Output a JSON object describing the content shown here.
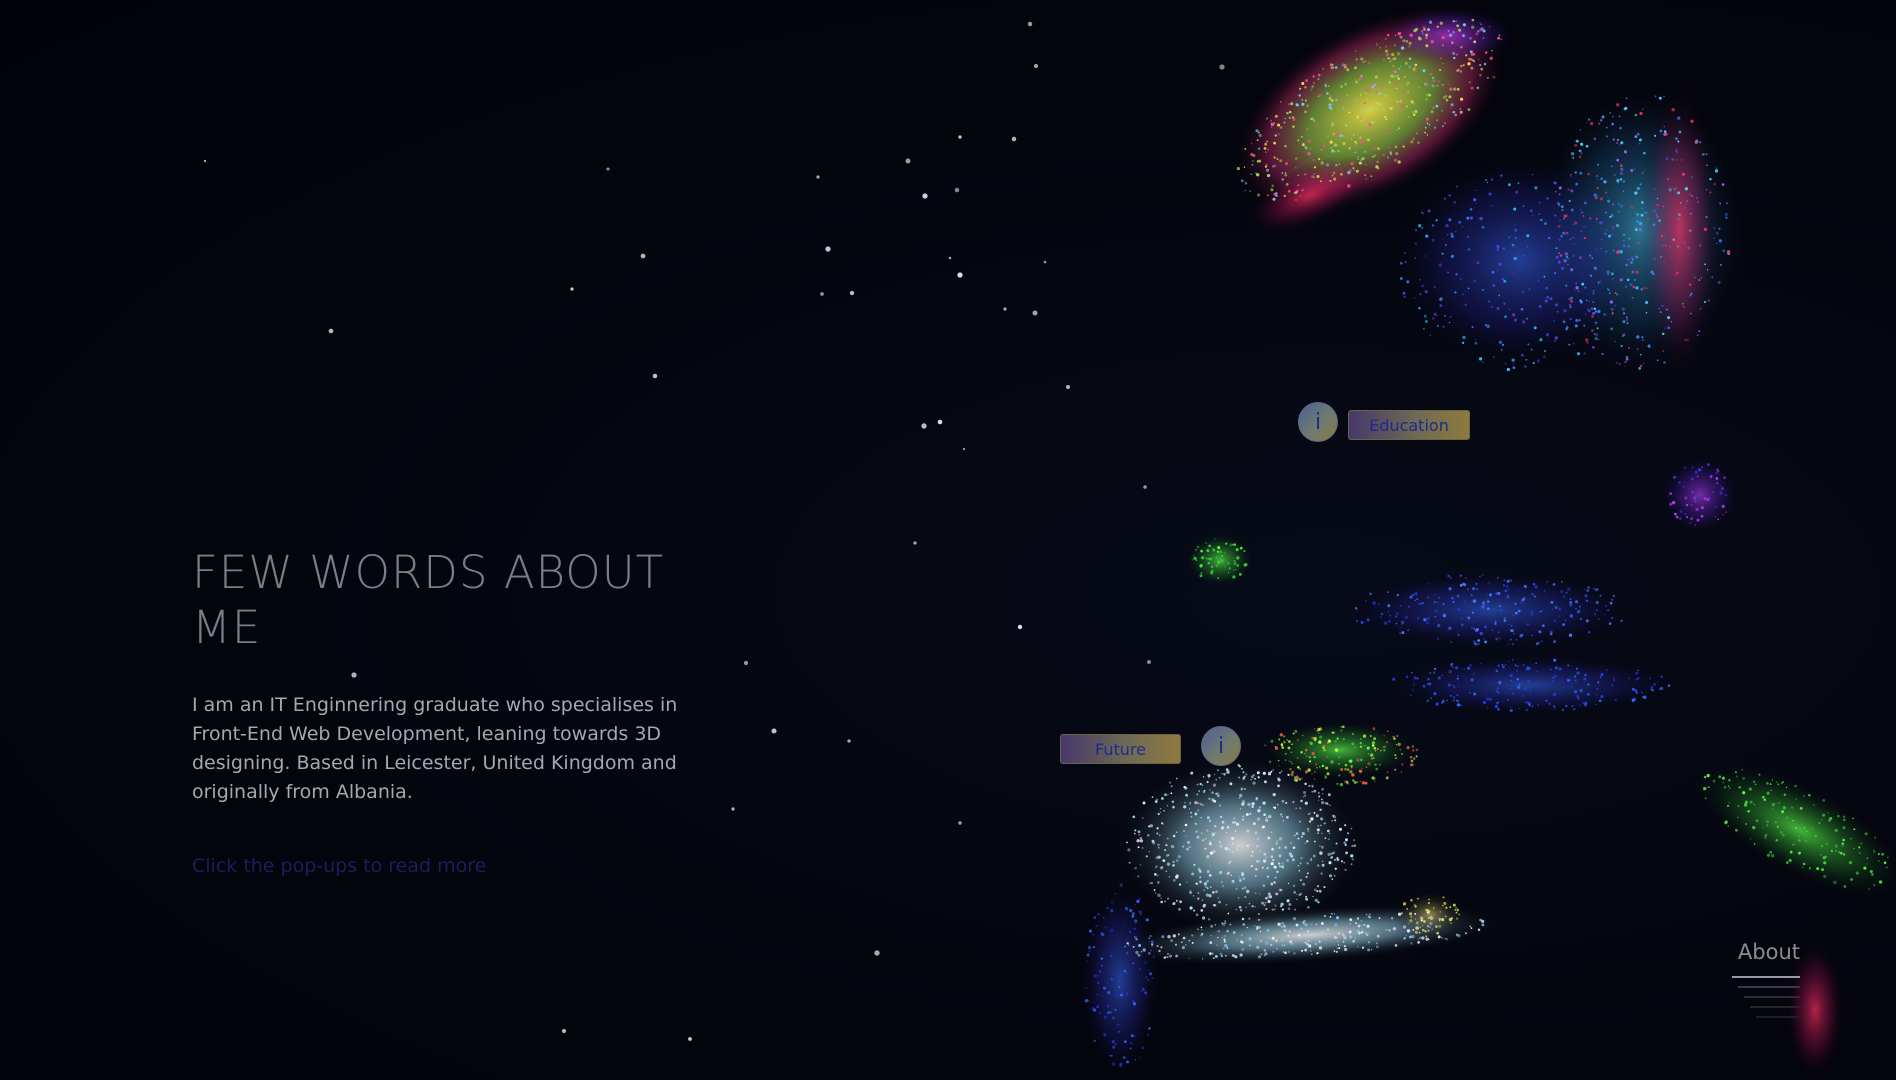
{
  "about": {
    "title": "FEW WORDS ABOUT ME",
    "text": "I am an IT Enginnering graduate who specialises in Front-End Web Development, leaning towards 3D designing. Based in Leicester, United Kingdom and originally from Albania.",
    "hint": "Click the pop-ups to read more"
  },
  "hotspots": {
    "education": {
      "icon_label": "i",
      "label": "Education"
    },
    "future": {
      "icon_label": "i",
      "label": "Future"
    }
  },
  "nav": {
    "active_label": "About"
  },
  "colors": {
    "background": "#03040c",
    "title": "#7d7d8a",
    "body_text": "#a7a7b0",
    "hint_text": "#1b1e5a",
    "popup_text": "#1f2a8c"
  }
}
